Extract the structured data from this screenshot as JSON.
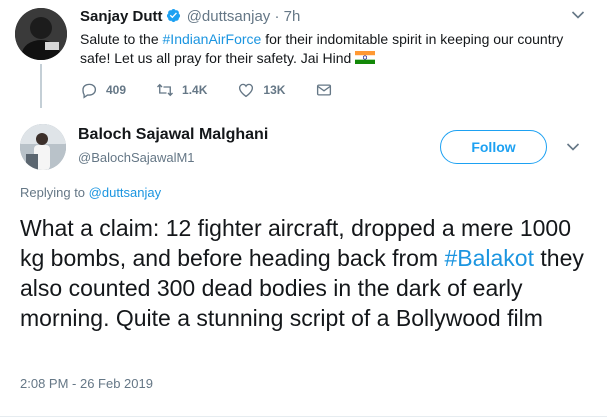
{
  "parent_tweet": {
    "author_name": "Sanjay Dutt",
    "author_handle": "@duttsanjay",
    "separator": "·",
    "time": "7h",
    "text_before": "Salute to the ",
    "hashtag": "#IndianAirForce",
    "text_after": " for their indomitable spirit in keeping our country safe! Let us all pray for their safety. Jai Hind",
    "reply_count": "409",
    "retweet_count": "1.4K",
    "like_count": "13K"
  },
  "reply_tweet": {
    "author_name": "Baloch Sajawal Malghani",
    "author_handle": "@BalochSajawalM1",
    "follow_label": "Follow",
    "replying_label": "Replying to ",
    "replying_mention": "@duttsanjay",
    "text_before": "What a claim: 12 fighter aircraft, dropped a mere 1000 kg bombs, and before heading back from ",
    "hashtag": "#Balakot",
    "text_after": " they also counted 300 dead bodies in the dark of early morning. Quite a stunning script of a Bollywood film",
    "timestamp": "2:08 PM - 26 Feb 2019"
  },
  "icons": {
    "verified": "verified-badge-icon",
    "caret": "chevron-down-icon",
    "reply": "reply-icon",
    "retweet": "retweet-icon",
    "like": "heart-icon",
    "message": "envelope-icon",
    "flag": "india-flag-icon"
  },
  "colors": {
    "accent": "#1da1f2",
    "link": "#1b95e0",
    "muted": "#657786",
    "text": "#14171a"
  }
}
